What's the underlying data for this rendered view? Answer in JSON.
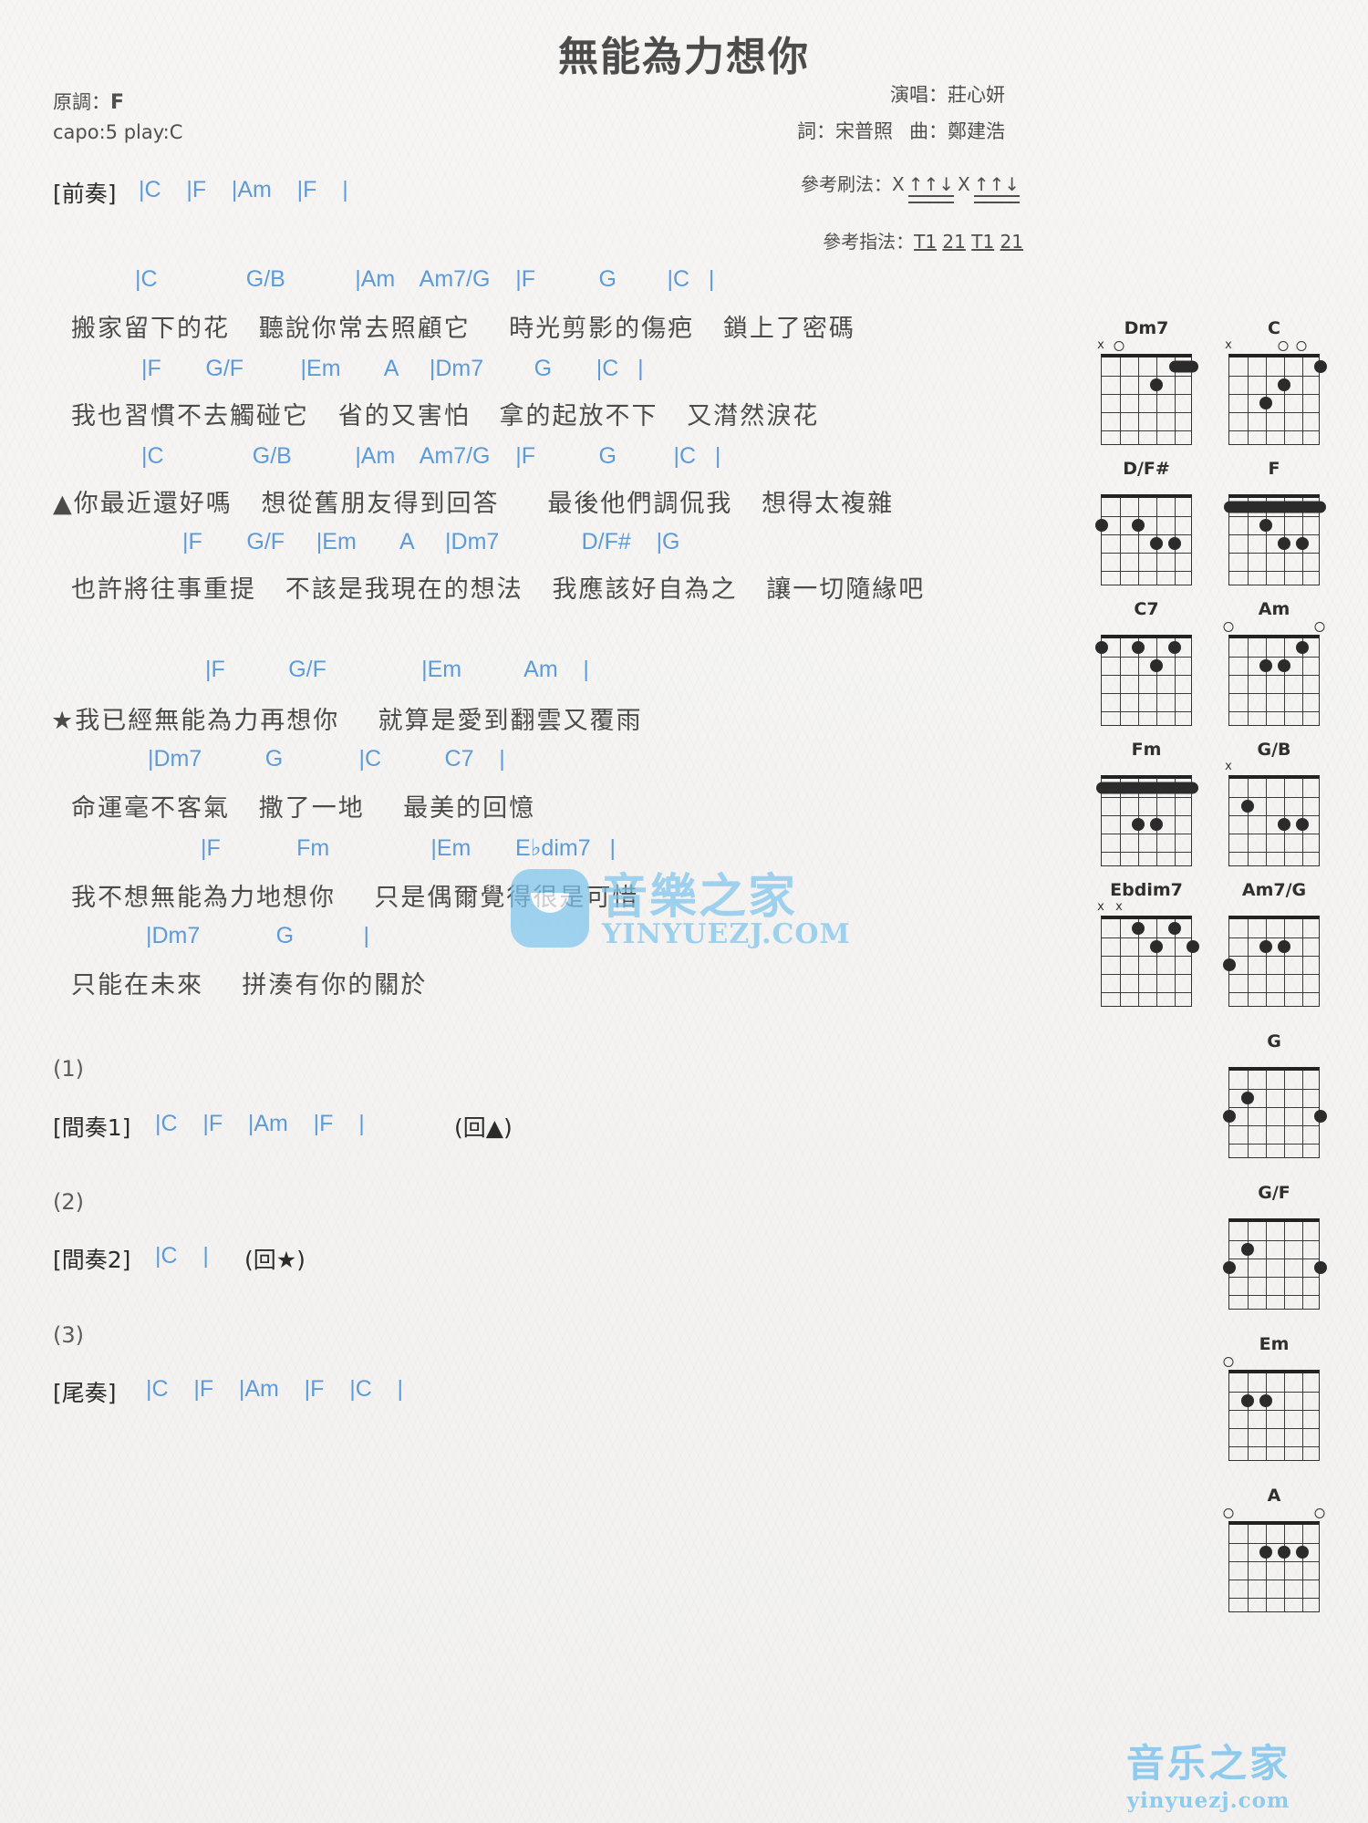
{
  "header": {
    "title": "無能為力想你",
    "original_key_label": "原調：",
    "original_key": "F",
    "capo_line": "capo:5 play:C",
    "singer": "演唱：莊心妍",
    "lyricist": "詞：宋普照",
    "composer": "曲：鄭建浩",
    "strum_label": "參考刷法：",
    "strum_pattern": "X ↑↑↓ X ↑↑↓",
    "strum_tokens": [
      "X",
      "↑↑↓",
      "X",
      "↑↑↓"
    ],
    "finger_label": "參考指法：",
    "finger_pattern": "T1 21 T1 21",
    "finger_tokens": [
      "T1",
      "21",
      "T1",
      "21"
    ]
  },
  "intro": {
    "label": "[前奏]",
    "chords": "|C    |F    |Am    |F    |"
  },
  "verses": [
    {
      "chords": "|C              G/B           |Am    Am7/G    |F          G        |C   |",
      "lyrics": "搬家留下的花   聽說你常去照顧它    時光剪影的傷疤   鎖上了密碼"
    },
    {
      "chords": "|F       G/F         |Em       A     |Dm7        G       |C   |",
      "lyrics": "我也習慣不去觸碰它   省的又害怕   拿的起放不下   又潸然淚花"
    },
    {
      "chords": "|C              G/B          |Am    Am7/G    |F          G         |C   |",
      "lyrics": "▲你最近還好嗎   想從舊朋友得到回答     最後他們調侃我   想得太複雜"
    },
    {
      "chords": "|F       G/F     |Em       A     |Dm7             D/F#    |G",
      "lyrics": "也許將往事重提   不該是我現在的想法   我應該好自為之   讓一切隨緣吧"
    }
  ],
  "chorus": [
    {
      "chords": "|F          G/F               |Em          Am    |",
      "lyrics": "★我已經無能為力再想你    就算是愛到翻雲又覆雨"
    },
    {
      "chords": "|Dm7          G            |C          C7    |",
      "lyrics": "命運毫不客氣   撒了一地    最美的回憶"
    },
    {
      "chords": "|F            Fm                |Em       E♭dim7   |",
      "lyrics": "我不想無能為力地想你    只是偶爾覺得很是可惜",
      "chord_special": "Ebdim7"
    },
    {
      "chords": "|Dm7            G           |",
      "lyrics": "只能在未來    拼湊有你的關於"
    }
  ],
  "endings": [
    {
      "num": "(1)",
      "label": "[間奏1]",
      "chords": "|C    |F    |Am    |F    |",
      "repeat": "(回▲)"
    },
    {
      "num": "(2)",
      "label": "[間奏2]",
      "chords": "|C    |",
      "repeat": "(回★)"
    },
    {
      "num": "(3)",
      "label": "[尾奏]",
      "chords": "|C    |F    |Am    |F    |C    |",
      "repeat": ""
    }
  ],
  "chord_diagrams": [
    {
      "name": "Dm7",
      "markers": [
        {
          "string": 1,
          "type": "mute"
        },
        {
          "string": 2,
          "type": "open"
        }
      ],
      "dots": [
        {
          "string": 4,
          "fret": 2
        }
      ],
      "barre": {
        "fret": 1,
        "from": 5,
        "to": 6
      }
    },
    {
      "name": "C",
      "markers": [
        {
          "string": 1,
          "type": "mute"
        },
        {
          "string": 4,
          "type": "open"
        },
        {
          "string": 5,
          "type": "open"
        }
      ],
      "dots": [
        {
          "string": 3,
          "fret": 3
        },
        {
          "string": 4,
          "fret": 2
        },
        {
          "string": 6,
          "fret": 1
        }
      ],
      "barre": null
    },
    {
      "name": "D/F#",
      "markers": [],
      "dots": [
        {
          "string": 1,
          "fret": 2
        },
        {
          "string": 3,
          "fret": 2
        },
        {
          "string": 4,
          "fret": 3
        },
        {
          "string": 5,
          "fret": 3
        }
      ],
      "barre": null
    },
    {
      "name": "F",
      "markers": [],
      "dots": [
        {
          "string": 3,
          "fret": 2
        },
        {
          "string": 4,
          "fret": 3
        },
        {
          "string": 5,
          "fret": 3
        }
      ],
      "barre": {
        "fret": 1,
        "from": 1,
        "to": 6
      }
    },
    {
      "name": "C7",
      "markers": [],
      "dots": [
        {
          "string": 1,
          "fret": 1
        },
        {
          "string": 3,
          "fret": 1
        },
        {
          "string": 5,
          "fret": 1
        },
        {
          "string": 4,
          "fret": 2
        }
      ],
      "barre": null
    },
    {
      "name": "Am",
      "markers": [
        {
          "string": 1,
          "type": "open"
        },
        {
          "string": 6,
          "type": "open"
        }
      ],
      "dots": [
        {
          "string": 3,
          "fret": 2
        },
        {
          "string": 4,
          "fret": 2
        },
        {
          "string": 5,
          "fret": 1
        }
      ],
      "barre": null
    },
    {
      "name": "Fm",
      "markers": [],
      "dots": [
        {
          "string": 3,
          "fret": 3
        },
        {
          "string": 4,
          "fret": 3
        }
      ],
      "barre": {
        "fret": 1,
        "from": 1,
        "to": 6
      }
    },
    {
      "name": "G/B",
      "markers": [
        {
          "string": 1,
          "type": "mute"
        }
      ],
      "dots": [
        {
          "string": 2,
          "fret": 2
        },
        {
          "string": 4,
          "fret": 3
        },
        {
          "string": 5,
          "fret": 3
        }
      ],
      "barre": null
    },
    {
      "name": "Ebdim7",
      "markers": [
        {
          "string": 1,
          "type": "mute"
        },
        {
          "string": 2,
          "type": "mute"
        }
      ],
      "dots": [
        {
          "string": 3,
          "fret": 1
        },
        {
          "string": 4,
          "fret": 2
        },
        {
          "string": 5,
          "fret": 1
        },
        {
          "string": 6,
          "fret": 2
        }
      ],
      "barre": null
    },
    {
      "name": "Am7/G",
      "markers": [],
      "dots": [
        {
          "string": 1,
          "fret": 3
        },
        {
          "string": 3,
          "fret": 2
        },
        {
          "string": 4,
          "fret": 2
        }
      ],
      "barre": null
    },
    {
      "name": "G",
      "markers": [],
      "dots": [
        {
          "string": 1,
          "fret": 3
        },
        {
          "string": 2,
          "fret": 2
        },
        {
          "string": 6,
          "fret": 3
        }
      ],
      "barre": null
    },
    {
      "name": "G/F",
      "markers": [],
      "dots": [
        {
          "string": 1,
          "fret": 3
        },
        {
          "string": 2,
          "fret": 2
        },
        {
          "string": 6,
          "fret": 3
        }
      ],
      "barre": null
    },
    {
      "name": "Em",
      "markers": [
        {
          "string": 1,
          "type": "open"
        }
      ],
      "dots": [
        {
          "string": 2,
          "fret": 2
        },
        {
          "string": 3,
          "fret": 2
        }
      ],
      "barre": null
    },
    {
      "name": "A",
      "markers": [
        {
          "string": 1,
          "type": "open"
        },
        {
          "string": 6,
          "type": "open"
        }
      ],
      "dots": [
        {
          "string": 3,
          "fret": 2
        },
        {
          "string": 4,
          "fret": 2
        },
        {
          "string": 5,
          "fret": 2
        }
      ],
      "barre": null
    }
  ],
  "watermark": {
    "center_text": "音樂之家",
    "center_url": "YINYUEZJ.COM",
    "bottom_text": "音乐之家",
    "bottom_url": "yinyuezj.com"
  }
}
